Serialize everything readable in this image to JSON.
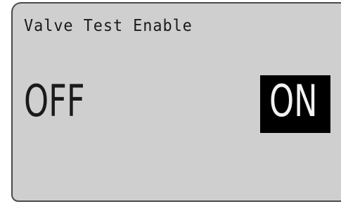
{
  "screen": {
    "title": "Valve Test Enable",
    "options": {
      "off_label": "OFF",
      "on_label": "ON"
    },
    "selected": "ON"
  },
  "colors": {
    "lcd_background": "#cfcfcf",
    "text": "#1a1a1a",
    "selection_background": "#000000",
    "selection_text": "#f2f2f2"
  }
}
